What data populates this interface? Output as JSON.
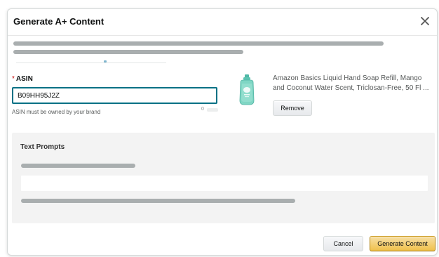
{
  "modal": {
    "title": "Generate A+ Content"
  },
  "asin": {
    "label": "ASIN",
    "required_marker": "*",
    "value": "B09HH95J2Z",
    "hint": "ASIN must be owned by your brand",
    "char_count": "0"
  },
  "product": {
    "title_line_1": "Amazon Basics Liquid Hand Soap Refill, Mango",
    "title_line_2": "and Coconut Water Scent, Triclosan-Free, 50 Fl ...",
    "remove_label": "Remove",
    "thumb_icon": "soap-bottle-icon"
  },
  "prompts": {
    "title": "Text Prompts"
  },
  "footer": {
    "cancel_label": "Cancel",
    "generate_label": "Generate Content"
  },
  "colors": {
    "accent": "#007185",
    "primary_button": "#f0c14b",
    "panel_background": "#f3f3f3"
  }
}
